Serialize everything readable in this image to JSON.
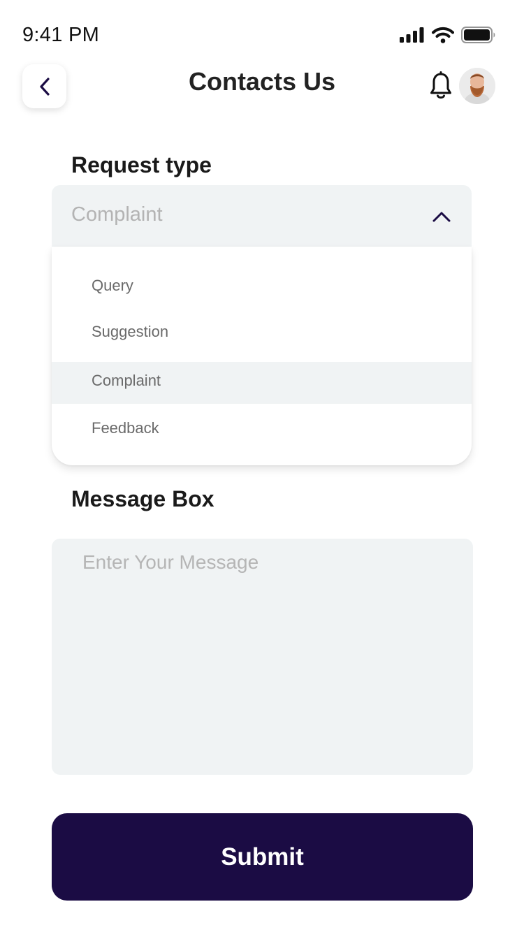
{
  "status_bar": {
    "time": "9:41 PM"
  },
  "header": {
    "title": "Contacts Us",
    "back_icon": "chevron-left-icon",
    "notification_icon": "bell-icon",
    "avatar_icon": "user-avatar"
  },
  "request_type": {
    "label": "Request type",
    "selected_value": "Complaint",
    "expanded": true,
    "chevron_icon": "chevron-up-icon",
    "options": [
      {
        "label": "Query",
        "selected": false
      },
      {
        "label": "Suggestion",
        "selected": false
      },
      {
        "label": "Complaint",
        "selected": true
      },
      {
        "label": "Feedback",
        "selected": false
      }
    ]
  },
  "message": {
    "label": "Message Box",
    "placeholder": "Enter Your Message",
    "value": ""
  },
  "submit": {
    "label": "Submit"
  },
  "colors": {
    "primary": "#1b0c44",
    "field_background": "#f0f3f4",
    "placeholder": "#b3b3b3",
    "option_text": "#6a6a6a",
    "title_text": "#222222"
  }
}
